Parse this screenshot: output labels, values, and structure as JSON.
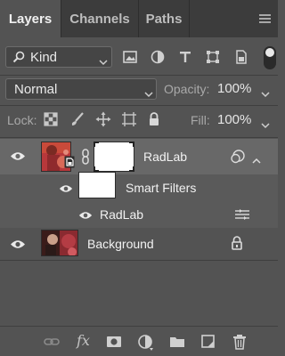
{
  "tabs": [
    {
      "label": "Layers",
      "active": true
    },
    {
      "label": "Channels",
      "active": false
    },
    {
      "label": "Paths",
      "active": false
    }
  ],
  "filter": {
    "kind_label": "Kind",
    "icons": [
      "image-filter-icon",
      "adjustment-filter-icon",
      "type-filter-icon",
      "shape-filter-icon",
      "smart-object-filter-icon"
    ],
    "toggle_on": true
  },
  "blend": {
    "mode": "Normal",
    "opacity_label": "Opacity:",
    "opacity_value": "100%"
  },
  "lock": {
    "label": "Lock:",
    "icons": [
      "lock-transparent-pixels-icon",
      "lock-image-pixels-icon",
      "lock-position-icon",
      "lock-artboard-icon",
      "lock-all-icon"
    ],
    "fill_label": "Fill:",
    "fill_value": "100%"
  },
  "layers": {
    "radlab": {
      "name": "RadLab",
      "visible": true,
      "selected": true
    },
    "smart_filters": {
      "name": "Smart Filters",
      "visible": true
    },
    "filter_item": {
      "name": "RadLab",
      "visible": true
    },
    "background": {
      "name": "Background",
      "visible": true,
      "locked": true
    }
  },
  "bottom_bar": [
    "link-layers-icon",
    "fx-icon",
    "add-mask-icon",
    "adjustment-layer-icon",
    "new-group-icon",
    "new-layer-icon",
    "delete-layer-icon"
  ],
  "fx_text": "fx",
  "colors": {
    "panel_bg": "#535353",
    "tab_bar_bg": "#3c3c3c",
    "selected_row_bg": "#686868",
    "text": "#f2f2f2"
  }
}
